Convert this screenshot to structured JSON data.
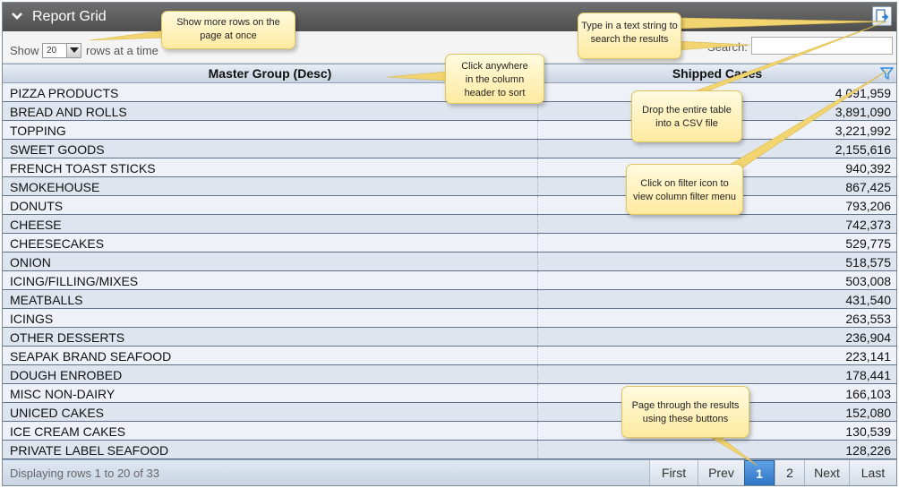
{
  "title": "Report Grid",
  "controls": {
    "show_label": "Show",
    "page_size": "20",
    "rows_label": "rows at a time",
    "search_label": "Search:",
    "search_value": ""
  },
  "columns": [
    "Master Group (Desc)",
    "Shipped Cases"
  ],
  "rows": [
    {
      "name": "PIZZA PRODUCTS",
      "value": "4,091,959"
    },
    {
      "name": "BREAD AND ROLLS",
      "value": "3,891,090"
    },
    {
      "name": "TOPPING",
      "value": "3,221,992"
    },
    {
      "name": "SWEET GOODS",
      "value": "2,155,616"
    },
    {
      "name": "FRENCH TOAST STICKS",
      "value": "940,392"
    },
    {
      "name": "SMOKEHOUSE",
      "value": "867,425"
    },
    {
      "name": "DONUTS",
      "value": "793,206"
    },
    {
      "name": "CHEESE",
      "value": "742,373"
    },
    {
      "name": "CHEESECAKES",
      "value": "529,775"
    },
    {
      "name": "ONION",
      "value": "518,575"
    },
    {
      "name": "ICING/FILLING/MIXES",
      "value": "503,008"
    },
    {
      "name": "MEATBALLS",
      "value": "431,540"
    },
    {
      "name": "ICINGS",
      "value": "263,553"
    },
    {
      "name": "OTHER DESSERTS",
      "value": "236,904"
    },
    {
      "name": "SEAPAK BRAND SEAFOOD",
      "value": "223,141"
    },
    {
      "name": "DOUGH ENROBED",
      "value": "178,441"
    },
    {
      "name": "MISC NON-DAIRY",
      "value": "166,103"
    },
    {
      "name": "UNICED CAKES",
      "value": "152,080"
    },
    {
      "name": "ICE CREAM CAKES",
      "value": "130,539"
    },
    {
      "name": "PRIVATE LABEL SEAFOOD",
      "value": "128,226"
    }
  ],
  "footer": {
    "info": "Displaying rows 1 to 20 of 33",
    "first": "First",
    "prev": "Prev",
    "page1": "1",
    "page2": "2",
    "next": "Next",
    "last": "Last"
  },
  "callouts": {
    "show": [
      "Show more rows on the",
      "page at once"
    ],
    "search": [
      "Type in a text string to",
      "search the results"
    ],
    "sort": [
      "Click anywhere",
      "in the column",
      "header to sort"
    ],
    "csv": [
      "Drop the entire table",
      "into a CSV file"
    ],
    "filter": [
      "Click on filter icon to",
      "view column filter menu"
    ],
    "page": [
      "Page through the results",
      "using these buttons"
    ]
  },
  "icons": {
    "collapse": "chevron-down-icon",
    "export": "export-csv-icon",
    "filter": "filter-funnel-icon",
    "dropdown": "dropdown-arrow-icon"
  },
  "colors": {
    "accent": "#2f74c4",
    "callout": "#ffeaa0",
    "title_bar": "#5a5a5a"
  }
}
